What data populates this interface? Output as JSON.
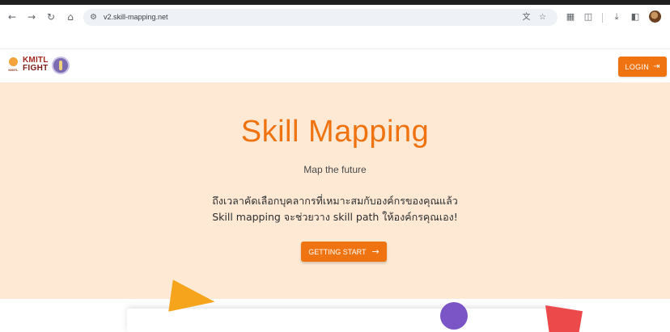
{
  "browser": {
    "url": "v2.skill-mapping.net",
    "icons": {
      "back": "back-arrow-icon",
      "forward": "forward-arrow-icon",
      "reload": "reload-icon",
      "home": "home-icon",
      "site_settings": "tune-icon",
      "translate": "translate-icon",
      "bookmark": "star-icon",
      "extension1": "extension-icon",
      "extensions": "puzzle-icon",
      "download": "download-icon",
      "sidepanel": "side-panel-icon",
      "profile": "profile-avatar"
    }
  },
  "header": {
    "logo_text_line1": "KMITL",
    "logo_text_line2": "FIGHT",
    "login_label": "LOGIN"
  },
  "hero": {
    "title": "Skill Mapping",
    "subtitle": "Map the future",
    "description_line1": "ถึงเวลาคัดเลือกบุคลากรที่เหมาะสมกับองค์กรของคุณแล้ว",
    "description_line2": "Skill mapping จะช่วยวาง skill path ให้องค์กรคุณเอง!",
    "cta_label": "GETTING START"
  },
  "colors": {
    "accent": "#ef7311",
    "hero_bg": "#fde9d4",
    "shape_yellow": "#f7a41d",
    "shape_purple": "#7b54c6",
    "shape_red": "#ec4a4a"
  }
}
